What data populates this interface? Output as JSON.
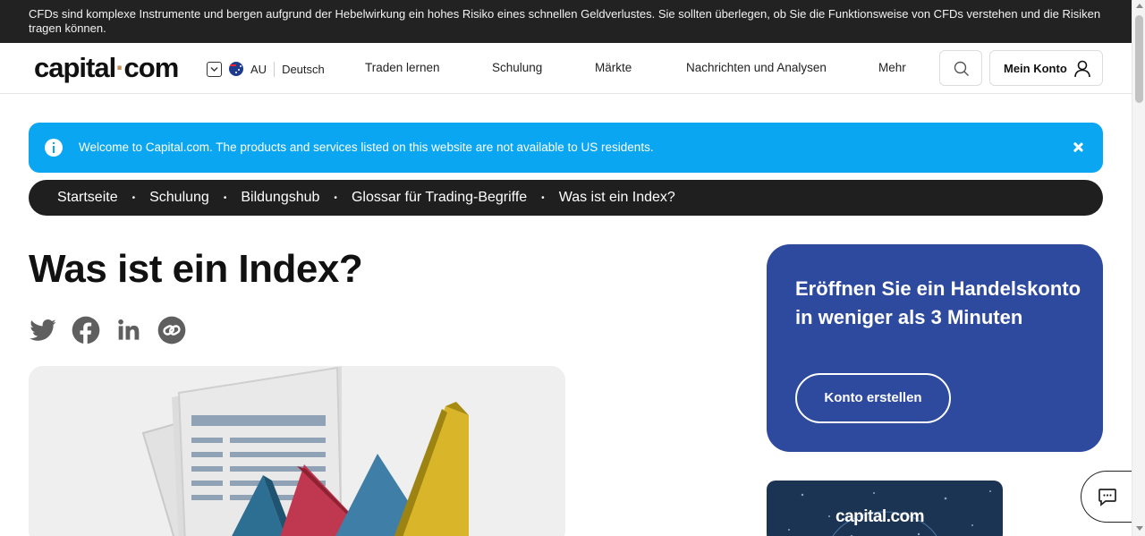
{
  "risk_warning": "CFDs sind komplexe Instrumente und bergen aufgrund der Hebelwirkung ein hohes Risiko eines schnellen Geldverlustes. Sie sollten überlegen, ob Sie die Funktionsweise von CFDs verstehen und die Risiken tragen können.",
  "header": {
    "logo_left": "capital",
    "logo_dot": "·",
    "logo_right": "com",
    "region": "AU",
    "language": "Deutsch",
    "nav": [
      "Traden lernen",
      "Schulung",
      "Märkte",
      "Nachrichten und Analysen",
      "Mehr"
    ],
    "account_label": "Mein Konto"
  },
  "info_banner": {
    "message": "Welcome to Capital.com. The products and services listed on this website are not available to US residents."
  },
  "breadcrumb": [
    "Startseite",
    "Schulung",
    "Bildungshub",
    "Glossar für Trading-Begriffe",
    "Was ist ein Index?"
  ],
  "breadcrumb_separator": "•",
  "page_title": "Was ist ein Index?",
  "share_icons": [
    "twitter-icon",
    "facebook-icon",
    "linkedin-icon",
    "copy-link-icon"
  ],
  "cta": {
    "heading": "Eröffnen Sie ein Handelskonto in weniger als 3 Minuten",
    "button": "Konto erstellen"
  },
  "promo": {
    "logo": "capital.com"
  },
  "colors": {
    "risk_bg": "#222222",
    "info_bg": "#0aa6f2",
    "breadcrumb_bg": "#1f1f1f",
    "cta_bg": "#2e4a9e",
    "brand_dot": "#c8915c"
  }
}
